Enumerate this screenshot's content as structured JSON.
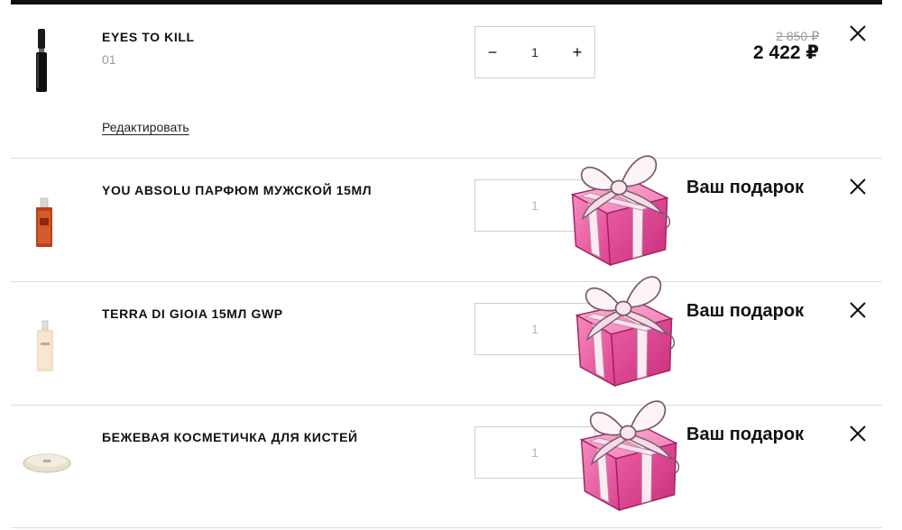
{
  "cart": {
    "items": [
      {
        "name": "EYES TO KILL",
        "variant": "01",
        "edit_label": "Редактировать",
        "quantity": "1",
        "old_price": "2 850 ₽",
        "price": "2 422 ₽",
        "is_gift": false
      },
      {
        "name": "YOU ABSOLU ПАРФЮМ МУЖСКОЙ 15МЛ",
        "quantity": "1",
        "gift_label": "Ваш подарок",
        "is_gift": true
      },
      {
        "name": "TERRA DI GIOIA 15МЛ GWP",
        "quantity": "1",
        "gift_label": "Ваш подарок",
        "is_gift": true
      },
      {
        "name": "БЕЖЕВАЯ КОСМЕТИЧКА ДЛЯ КИСТЕЙ",
        "quantity": "1",
        "gift_label": "Ваш подарок",
        "is_gift": true
      }
    ],
    "controls": {
      "minus": "−",
      "plus": "+"
    }
  },
  "icons": {
    "remove": "close-icon",
    "gift": "gift-box-icon",
    "qty_minus": "minus-icon",
    "qty_plus": "plus-icon"
  },
  "colors": {
    "gift_pink": "#ee5aa6",
    "gift_ribbon": "#fbeaf2",
    "divider": "#dcdcdc",
    "muted": "#9a9a9a"
  }
}
